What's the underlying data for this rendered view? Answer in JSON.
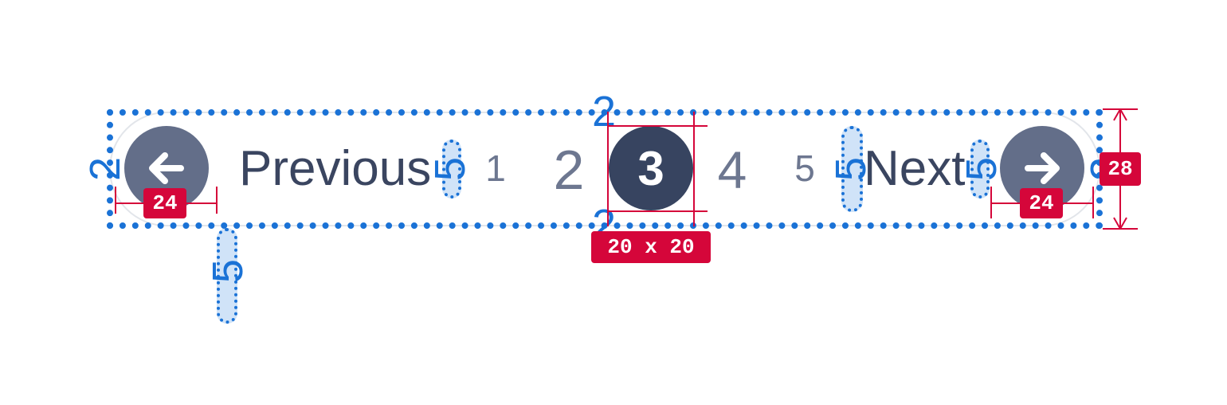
{
  "pagination": {
    "previous_label": "Previous",
    "next_label": "Next",
    "pages": [
      "1",
      "2",
      "3",
      "4",
      "5"
    ],
    "current_page": "3",
    "prev_icon": "arrow-left-icon",
    "next_icon": "arrow-right-icon"
  },
  "annotations": {
    "border_left": "2",
    "border_right": "2",
    "border_top": "2",
    "border_bottom": "2",
    "gap_prev_pages": "5",
    "gap_pages_next": "5",
    "gap_next_icon": "5",
    "gap_below": "5",
    "icon_width_left": "24",
    "icon_width_right": "24",
    "current_size": "20 x 20",
    "total_height": "28"
  },
  "colors": {
    "spec_blue": "#1a72d6",
    "spec_red": "#d5063a",
    "button_fill": "#636e89",
    "current_fill": "#374460"
  }
}
